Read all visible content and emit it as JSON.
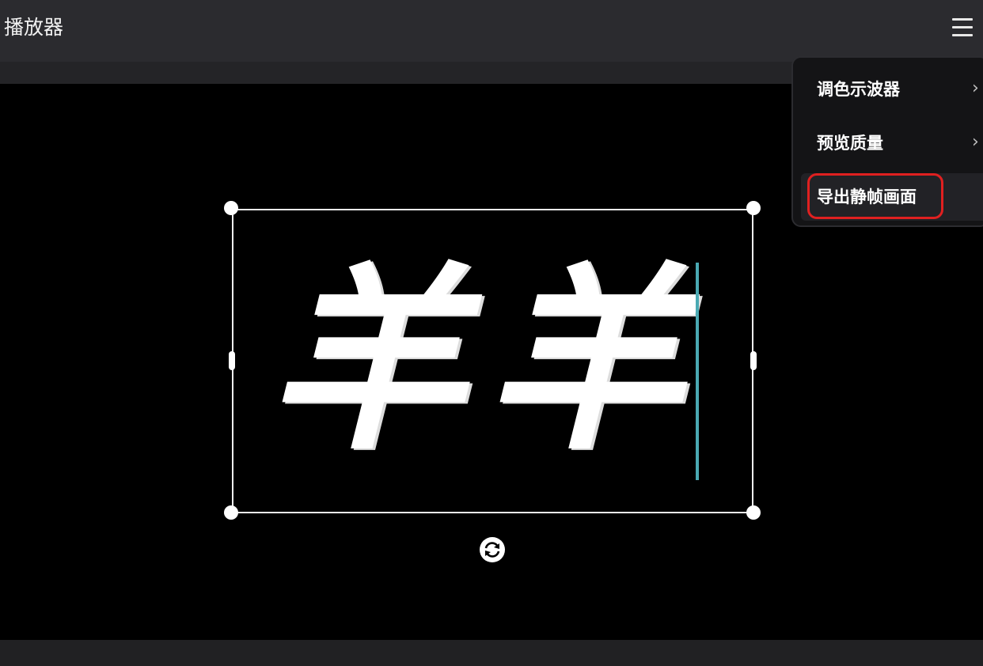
{
  "header": {
    "title": "播放器"
  },
  "preview": {
    "caption": [
      "羊",
      "羊"
    ]
  },
  "menu": {
    "items": [
      {
        "label": "调色示波器",
        "chevron": "›"
      },
      {
        "label": "预览质量",
        "chevron": "›"
      },
      {
        "label": "导出静帧画面"
      }
    ]
  },
  "colors": {
    "accent_cursor": "#4aa9b3",
    "highlight": "#e02020"
  }
}
